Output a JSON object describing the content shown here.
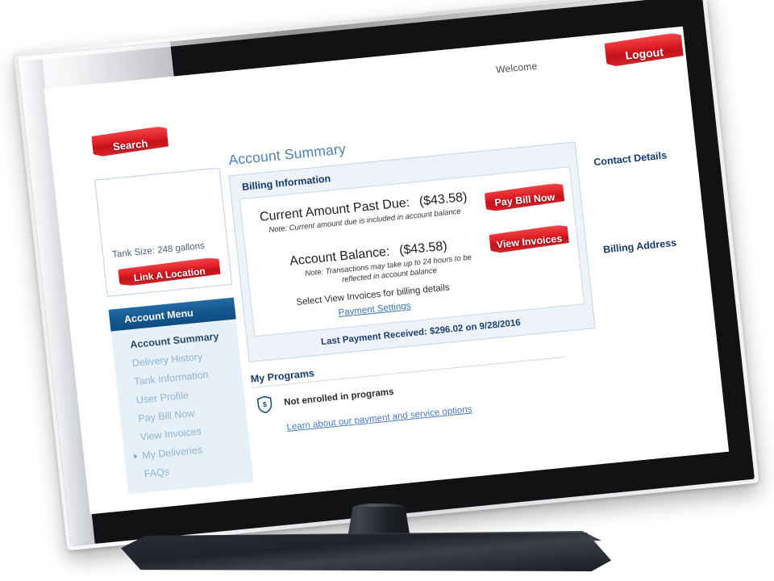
{
  "header": {
    "welcome_text": "Welcome",
    "logout_label": "Logout",
    "search_label": "Search"
  },
  "left_column": {
    "tank_size_label": "Tank Size:  248 gallons",
    "link_location_label": "Link A Location",
    "menu_title": "Account Menu",
    "menu_items": [
      {
        "label": "Account Summary",
        "active": true,
        "bullet": false
      },
      {
        "label": "Delivery History",
        "active": false,
        "bullet": false
      },
      {
        "label": "Tank Information",
        "active": false,
        "bullet": false
      },
      {
        "label": "User Profile",
        "active": false,
        "bullet": false
      },
      {
        "label": "Pay Bill Now",
        "active": false,
        "bullet": false
      },
      {
        "label": "View Invoices",
        "active": false,
        "bullet": false
      },
      {
        "label": "My Deliveries",
        "active": false,
        "bullet": true
      },
      {
        "label": "FAQs",
        "active": false,
        "bullet": false
      }
    ]
  },
  "main": {
    "page_title": "Account Summary",
    "billing_panel_title": "Billing Information",
    "past_due_label": "Current Amount Past Due:",
    "past_due_value": "($43.58)",
    "past_due_note": "Note: Current amount due is included in account balance",
    "pay_bill_label": "Pay Bill Now",
    "balance_label": "Account Balance:",
    "balance_value": "($43.58)",
    "balance_note": "Note: Transactions may take up to 24 hours to be reflected in account balance",
    "view_invoices_label": "View Invoices",
    "select_note": "Select View Invoices for billing details",
    "payment_settings_link": "Payment Settings",
    "last_payment": "Last Payment Received: $296.02 on 9/28/2016"
  },
  "programs": {
    "title": "My Programs",
    "status_text": "Not enrolled in programs",
    "icon_name": "shield-dollar-icon",
    "learn_link": "Learn about our payment and service options"
  },
  "right_column": {
    "contact_details_label": "Contact Details",
    "billing_address_label": "Billing Address"
  },
  "colors": {
    "brand_red": "#d8232b",
    "nav_blue": "#14568e",
    "heading_blue": "#16396b",
    "title_blue": "#4d7fb5",
    "panel_blue": "#eef3f9",
    "menu_bg": "#e5f0f8",
    "link_blue": "#4a7cc0"
  }
}
